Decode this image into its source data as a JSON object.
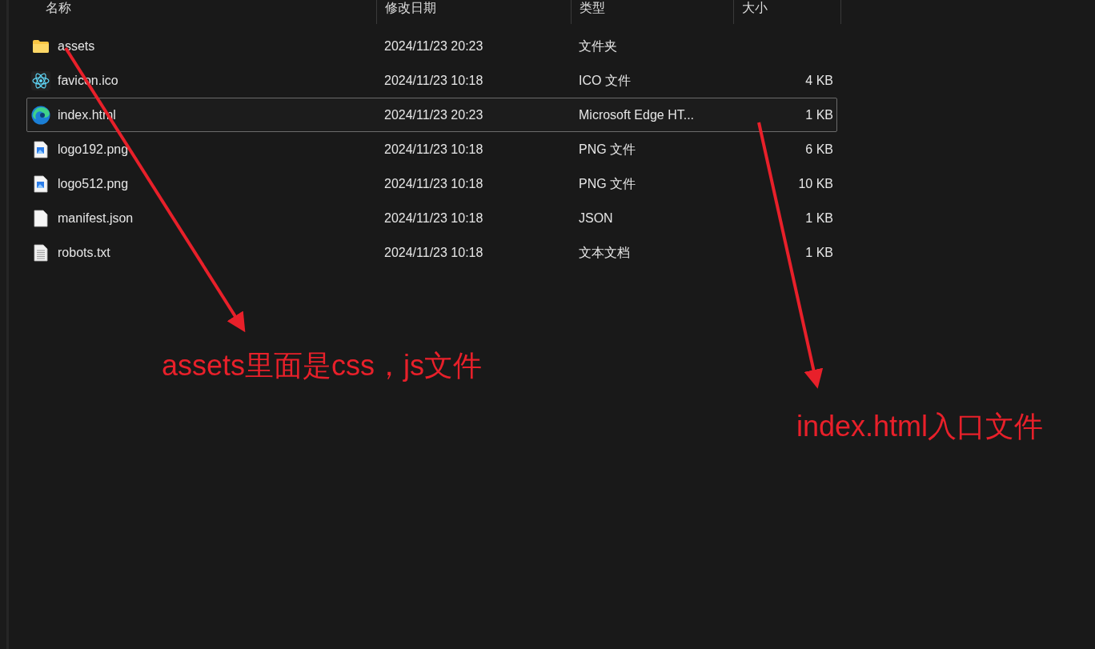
{
  "table": {
    "columns": [
      "名称",
      "修改日期",
      "类型",
      "大小"
    ],
    "rows": [
      {
        "kind": "folder",
        "name": "assets",
        "modified": "2024/11/23 20:23",
        "type": "文件夹",
        "size": "",
        "selected": false
      },
      {
        "kind": "react",
        "name": "favicon.ico",
        "modified": "2024/11/23 10:18",
        "type": "ICO 文件",
        "size": "4 KB",
        "selected": false
      },
      {
        "kind": "edge",
        "name": "index.html",
        "modified": "2024/11/23 20:23",
        "type": "Microsoft Edge HT...",
        "size": "1 KB",
        "selected": true
      },
      {
        "kind": "image",
        "name": "logo192.png",
        "modified": "2024/11/23 10:18",
        "type": "PNG 文件",
        "size": "6 KB",
        "selected": false
      },
      {
        "kind": "image",
        "name": "logo512.png",
        "modified": "2024/11/23 10:18",
        "type": "PNG 文件",
        "size": "10 KB",
        "selected": false
      },
      {
        "kind": "blank",
        "name": "manifest.json",
        "modified": "2024/11/23 10:18",
        "type": "JSON",
        "size": "1 KB",
        "selected": false
      },
      {
        "kind": "text",
        "name": "robots.txt",
        "modified": "2024/11/23 10:18",
        "type": "文本文档",
        "size": "1 KB",
        "selected": false
      }
    ]
  },
  "annotations": [
    {
      "text": "assets里面是css，js文件"
    },
    {
      "text": "index.html入口文件"
    }
  ]
}
